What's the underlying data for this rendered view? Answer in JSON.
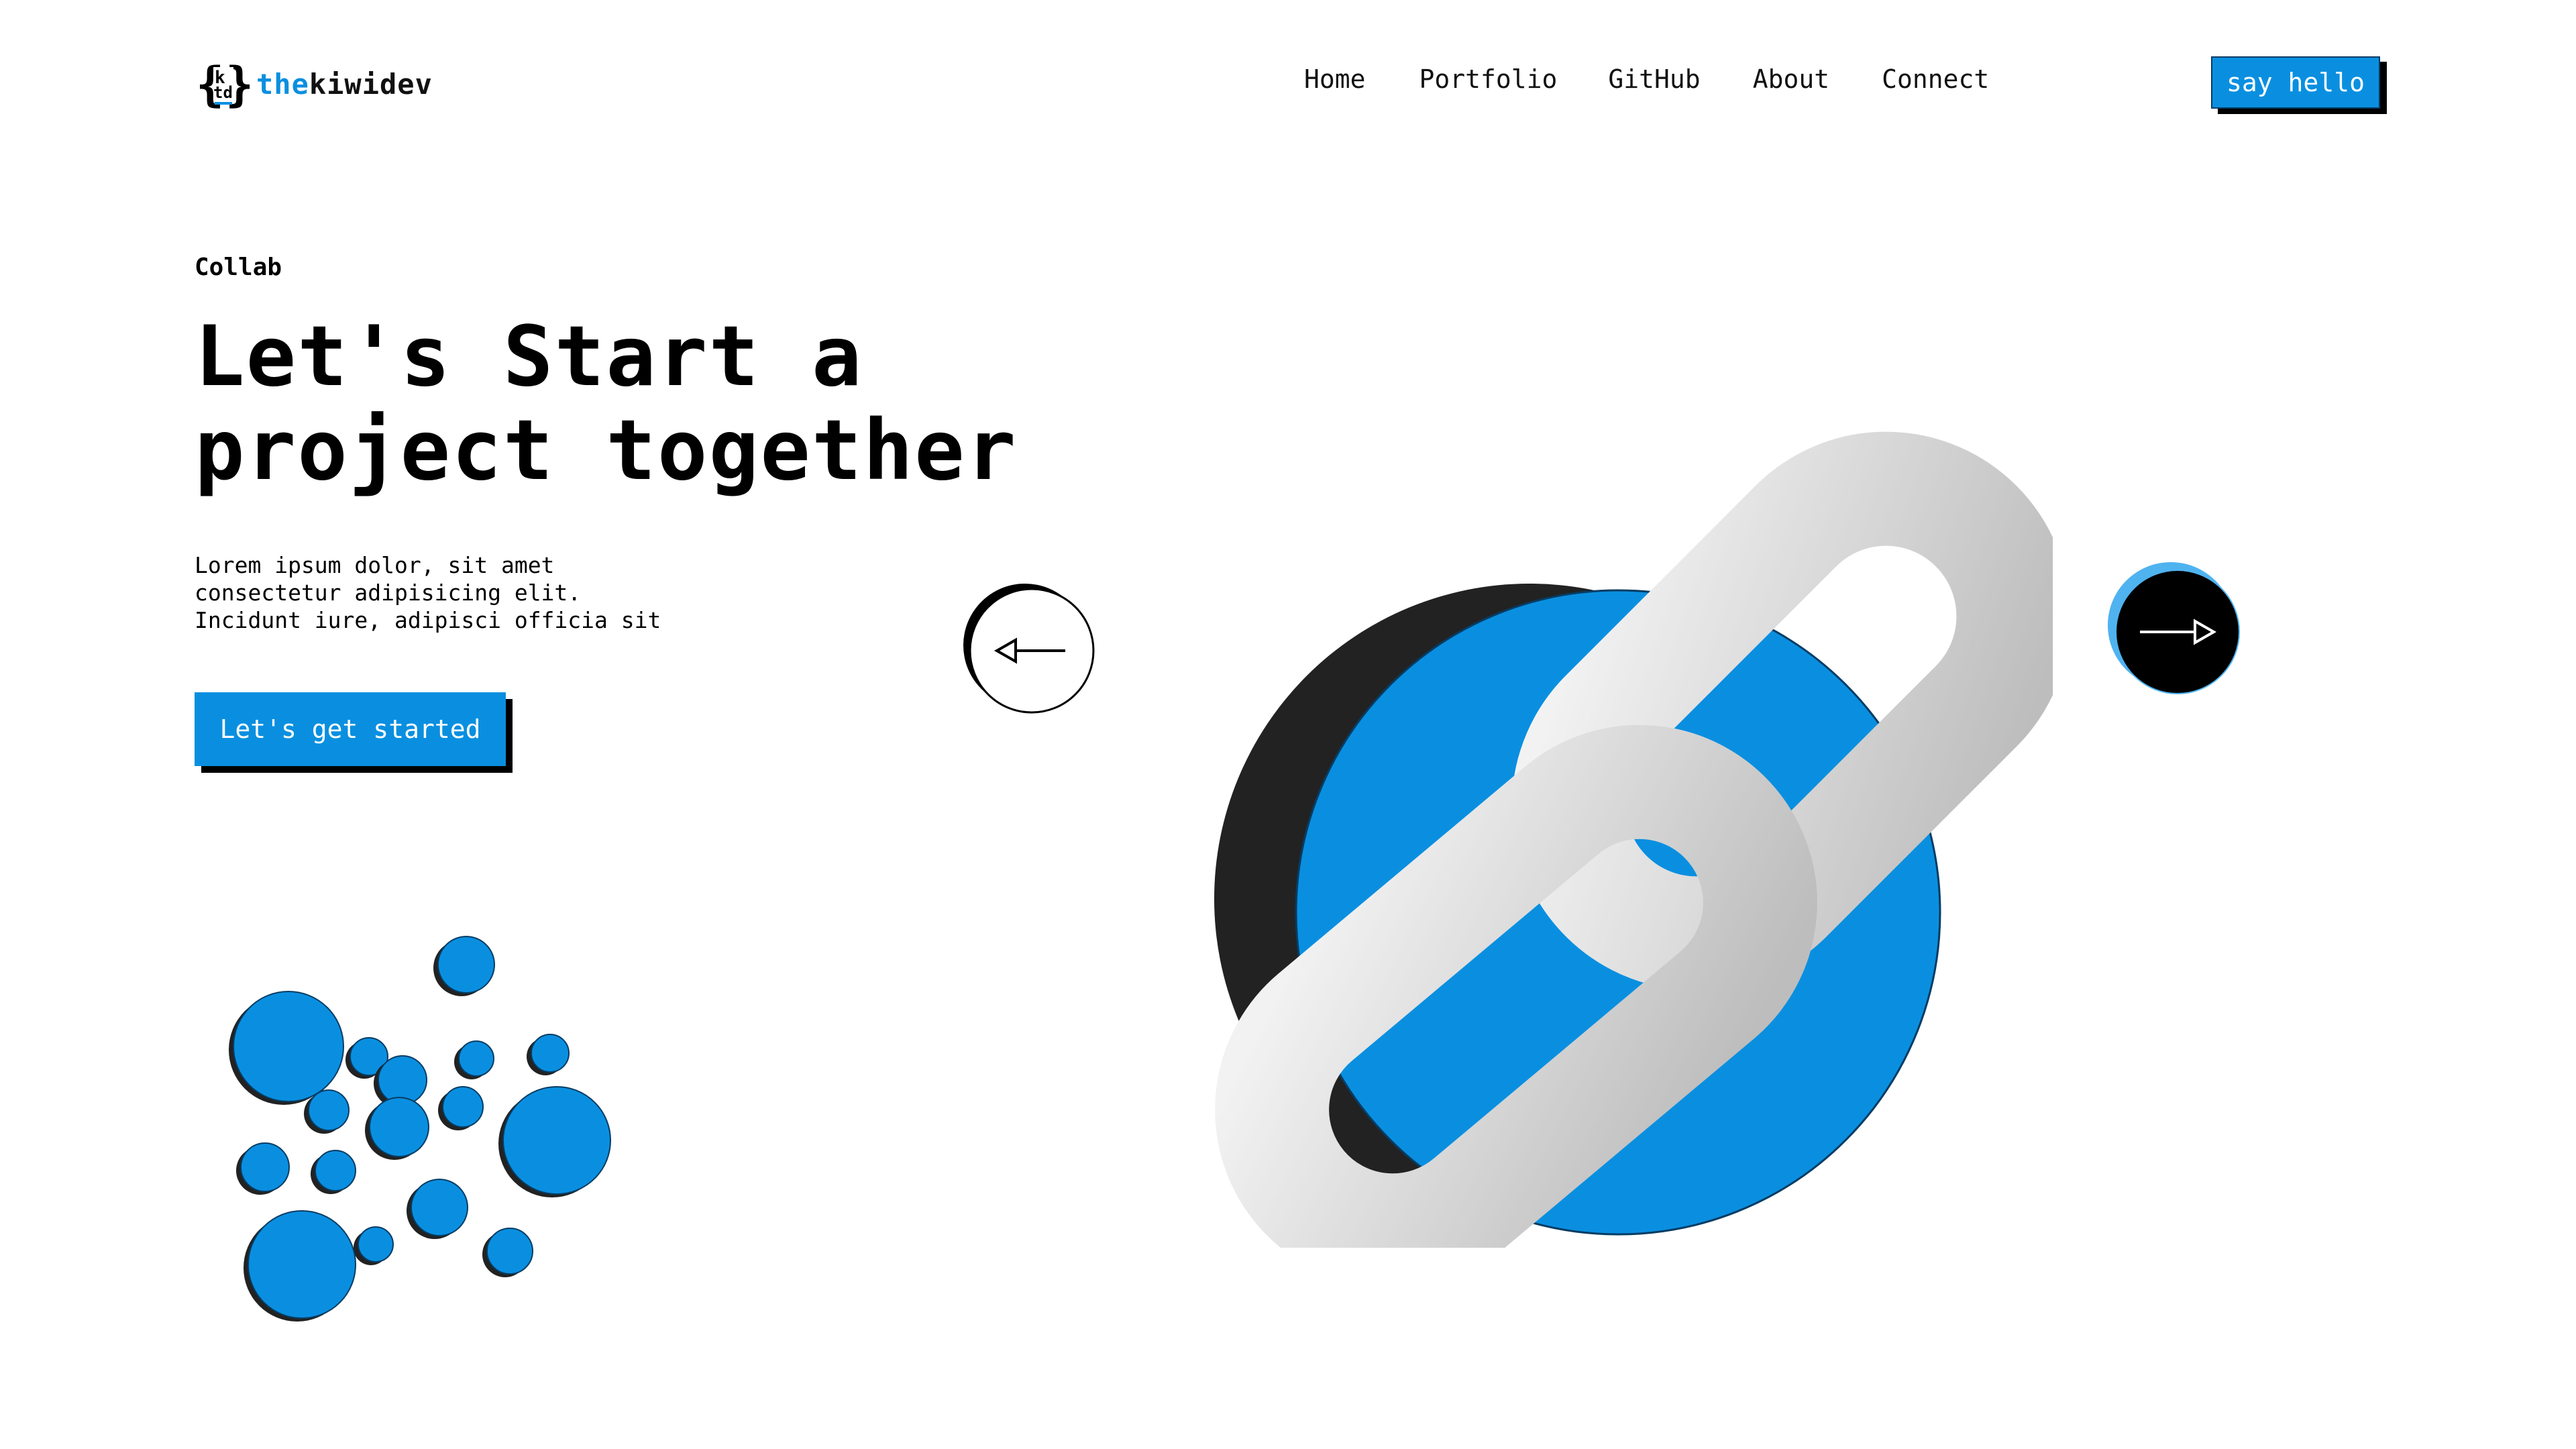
{
  "header": {
    "logo": {
      "mark_letters": "ktd",
      "name_parts": [
        {
          "text": "the",
          "color": "#0a8fe0"
        },
        {
          "text": "kiwi",
          "color": "#111111"
        },
        {
          "text": "dev",
          "color": "#111111"
        }
      ]
    },
    "nav": [
      {
        "label": "Home"
      },
      {
        "label": "Portfolio"
      },
      {
        "label": "GitHub"
      },
      {
        "label": "About"
      },
      {
        "label": "Connect"
      }
    ],
    "cta_label": "say hello"
  },
  "hero": {
    "eyebrow": "Collab",
    "headline_line1": "Let's Start a",
    "headline_line2": "project together",
    "description_lines": [
      "Lorem ipsum dolor, sit amet",
      "consectetur adipisicing elit.",
      "Incidunt iure, adipisci officia sit"
    ],
    "cta_label": "Let's get started"
  },
  "carousel": {
    "prev_icon": "arrow-left-icon",
    "next_icon": "arrow-right-icon"
  },
  "colors": {
    "accent": "#0a8fe0",
    "accent_light": "#4fb3f0",
    "dark": "#000000",
    "dark_circle": "#222222",
    "chain": "#d9d9d9"
  }
}
